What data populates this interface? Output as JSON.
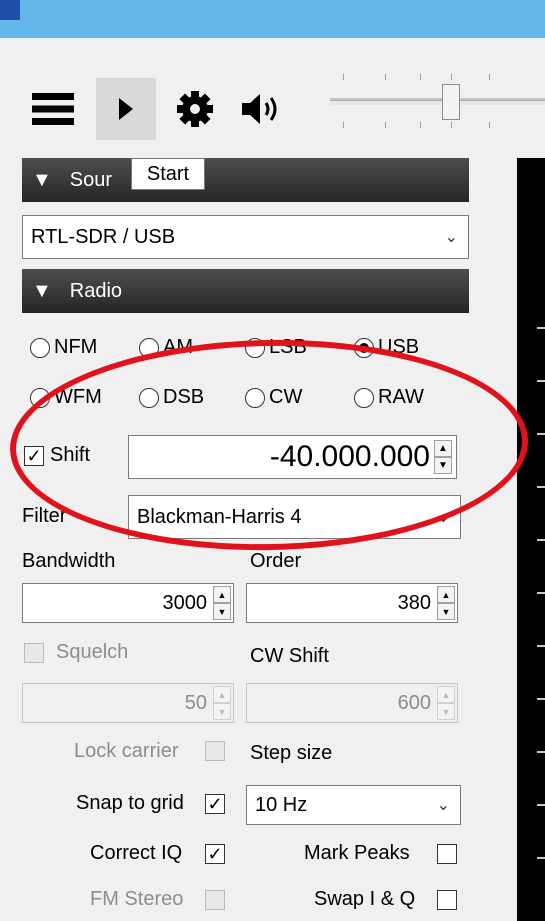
{
  "toolbar": {
    "icons": [
      "menu-icon",
      "play-icon",
      "gear-icon",
      "speaker-icon"
    ],
    "tooltip": "Start"
  },
  "source": {
    "header": "Sour",
    "device": "RTL-SDR / USB"
  },
  "radio": {
    "header": "Radio",
    "modes": [
      "NFM",
      "AM",
      "LSB",
      "USB",
      "WFM",
      "DSB",
      "CW",
      "RAW"
    ],
    "selected_mode": "USB",
    "shift_label": "Shift",
    "shift_checked": true,
    "frequency": "-40.000.000",
    "filter_label": "Filter",
    "filter_value": "Blackman-Harris 4",
    "bandwidth_label": "Bandwidth",
    "bandwidth_value": "3000",
    "order_label": "Order",
    "order_value": "380",
    "squelch_label": "Squelch",
    "squelch_value": "50",
    "cw_shift_label": "CW Shift",
    "cw_shift_value": "600",
    "lock_carrier_label": "Lock carrier",
    "step_size_label": "Step size",
    "snap_to_grid_label": "Snap to grid",
    "step_size_value": "10 Hz",
    "correct_iq_label": "Correct IQ",
    "mark_peaks_label": "Mark Peaks",
    "fm_stereo_label": "FM Stereo",
    "swap_iq_label": "Swap I & Q"
  },
  "colors": {
    "titlebar": "#63b7e9",
    "annotation": "#e0121b"
  }
}
